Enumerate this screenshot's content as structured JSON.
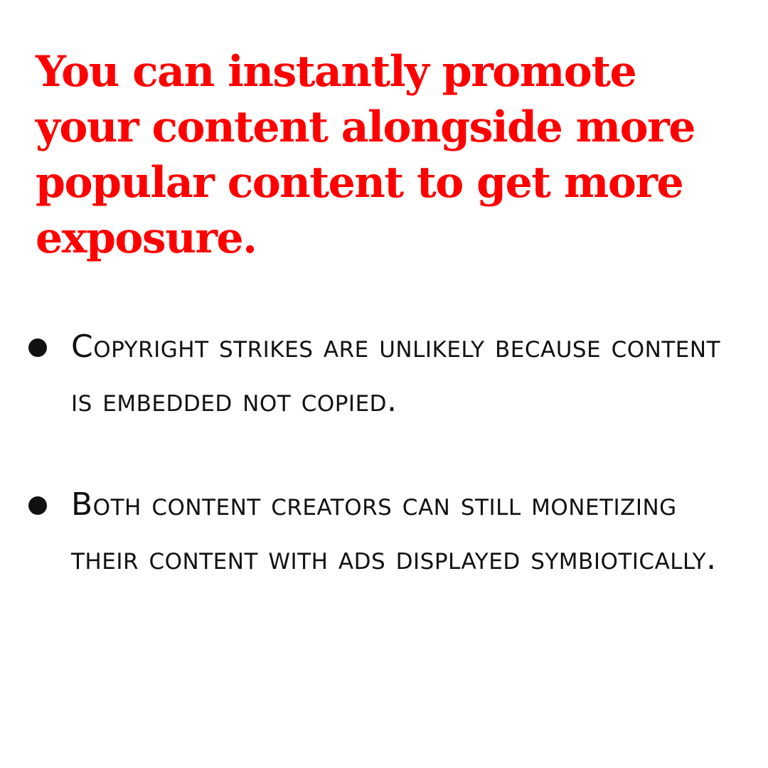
{
  "headline": "You can instantly promote your content alongside more popular content to get more exposure.",
  "bullets": [
    {
      "text": "Copyright strikes are unlikely because content is embedded not copied."
    },
    {
      "text": "Both content creators can still monetizing their content with ads displayed symbiotically."
    }
  ],
  "colors": {
    "headline": "#ff0000",
    "body_text": "#111111",
    "background": "#ffffff"
  },
  "icons": {
    "bullet": "bullet-dot-icon"
  }
}
